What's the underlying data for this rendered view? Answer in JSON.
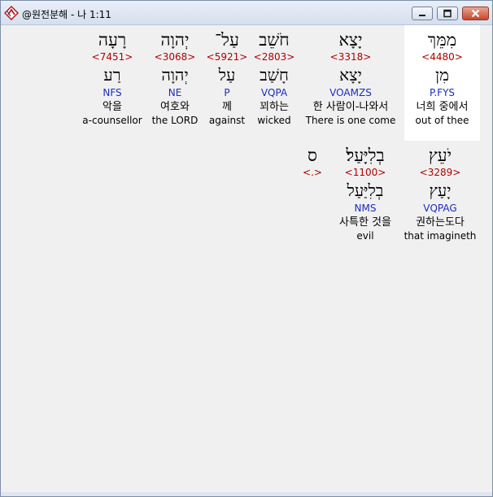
{
  "window": {
    "title": "@원전분해 - 나 1:11"
  },
  "row1": [
    {
      "hebrew": "מִמֵּךְ",
      "strong": "<4480>",
      "lemma": "מִן",
      "parse": "P.FYS",
      "korean": "너희 중에서",
      "english": "out of thee"
    },
    {
      "hebrew": "יָצָא",
      "strong": "<3318>",
      "lemma": "יָצָא",
      "parse": "VOAMZS",
      "korean": "한 사람이-나와서",
      "english": "There is one come"
    },
    {
      "hebrew": "חֹשֵׁב",
      "strong": "<2803>",
      "lemma": "חָשַׁב",
      "parse": "VQPA",
      "korean": "꾀하는",
      "english": "wicked"
    },
    {
      "hebrew": "עַל־",
      "strong": "<5921>",
      "lemma": "עַל",
      "parse": "P",
      "korean": "께",
      "english": "against"
    },
    {
      "hebrew": "יְהוָה",
      "strong": "<3068>",
      "lemma": "יְהוָה",
      "parse": "NE",
      "korean": "여호와",
      "english": "the LORD"
    },
    {
      "hebrew": "רָעָה",
      "strong": "<7451>",
      "lemma": "רַע",
      "parse": "NFS",
      "korean": "악을",
      "english": "a-counsellor"
    }
  ],
  "row2": [
    {
      "hebrew": "יֹעֵץ",
      "strong": "<3289>",
      "lemma": "יָעַץ",
      "parse": "VQPAG",
      "korean": "권하는도다",
      "english": "that imagineth"
    },
    {
      "hebrew": "בְלִיָּעַל׃",
      "strong": "<1100>",
      "lemma": "בְלִיַּעַל",
      "parse": "NMS",
      "korean": "사특한 것을",
      "english": "evil"
    },
    {
      "hebrew": "ס",
      "strong": "<.>",
      "lemma": "",
      "parse": "",
      "korean": "",
      "english": ""
    }
  ]
}
